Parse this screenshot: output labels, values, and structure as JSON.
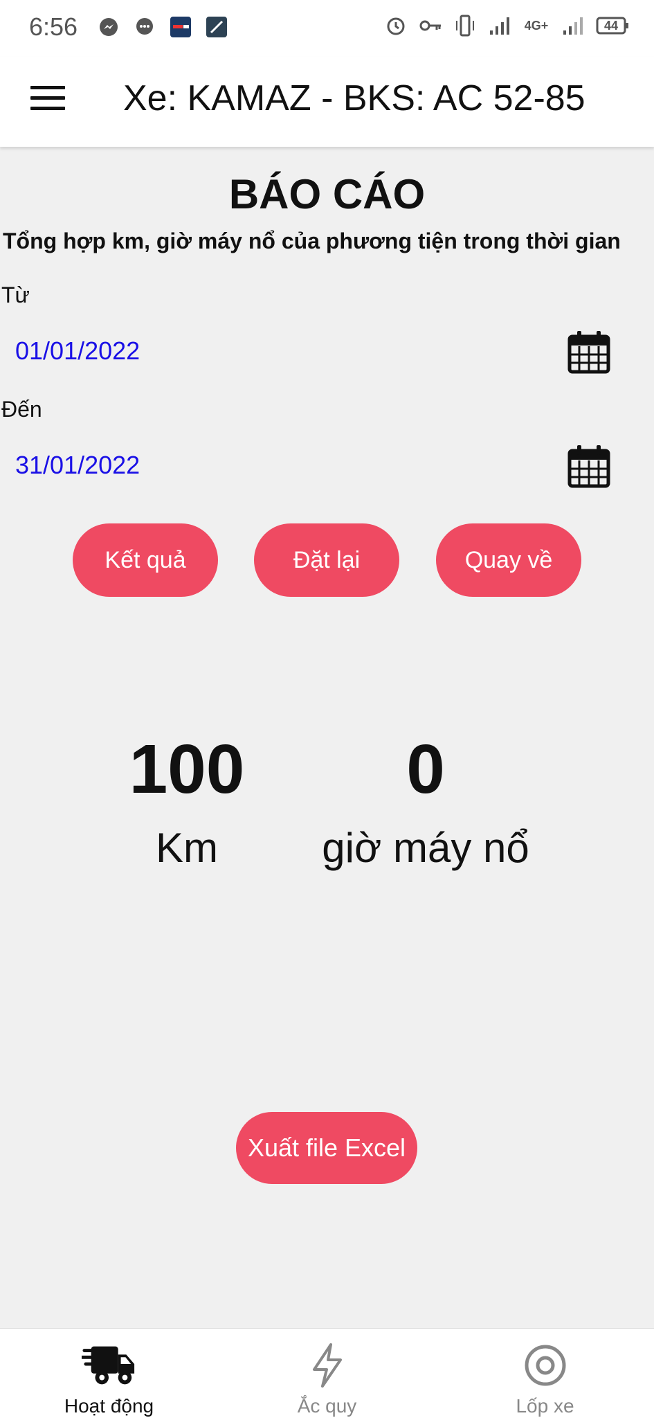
{
  "status_bar": {
    "time": "6:56",
    "battery": "44",
    "network": "4G+",
    "left_icons": [
      "messenger-icon",
      "chat-icon",
      "app-icon",
      "app-icon-2"
    ],
    "right_icons": [
      "alarm-icon",
      "key-icon",
      "vibrate-icon",
      "signal-icon",
      "network-icon",
      "signal-icon-2",
      "battery-icon"
    ]
  },
  "app_bar": {
    "title": "Xe: KAMAZ - BKS: AC 52-85"
  },
  "report": {
    "title": "BÁO CÁO",
    "subtitle": "Tổng hợp km, giờ máy nổ của phương tiện trong thời gian",
    "from_label": "Từ",
    "from_value": "01/01/2022",
    "to_label": "Đến",
    "to_value": "31/01/2022"
  },
  "buttons": {
    "result": "Kết quả",
    "reset": "Đặt lại",
    "back": "Quay về",
    "export": "Xuất file Excel"
  },
  "stats": {
    "km_value": "100",
    "km_label": "Km",
    "hours_value": "0",
    "hours_label": "giờ máy nổ"
  },
  "bottom_nav": {
    "items": [
      {
        "label": "Hoạt động",
        "icon": "truck-icon",
        "active": true
      },
      {
        "label": "Ắc quy",
        "icon": "lightning-icon",
        "active": false
      },
      {
        "label": "Lốp xe",
        "icon": "tire-icon",
        "active": false
      }
    ]
  },
  "colors": {
    "accent": "#ef4a62",
    "date_text": "#1a10e6",
    "background": "#f0f0f0"
  }
}
